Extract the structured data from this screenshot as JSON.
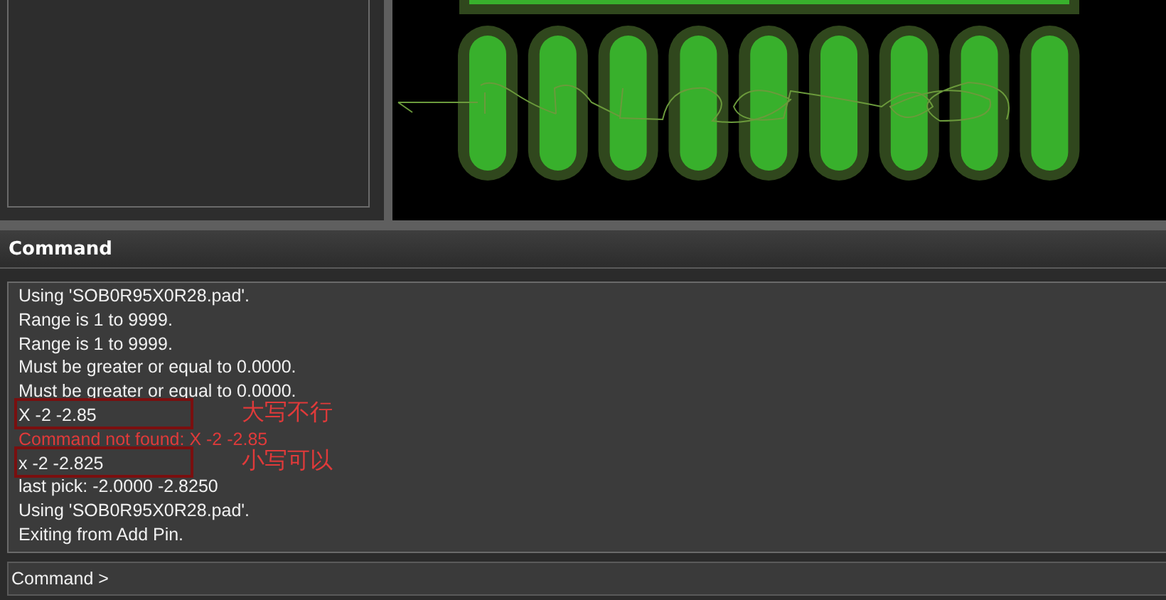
{
  "command_panel": {
    "title": "Command",
    "log": [
      {
        "text": "Using 'SOB0R95X0R28.pad'.",
        "kind": "info",
        "highlighted": false
      },
      {
        "text": "Range is 1 to 9999.",
        "kind": "info",
        "highlighted": false
      },
      {
        "text": "Range is 1 to 9999.",
        "kind": "info",
        "highlighted": false
      },
      {
        "text": "Must be greater or equal to 0.0000.",
        "kind": "info",
        "highlighted": false
      },
      {
        "text": "Must be greater or equal to 0.0000.",
        "kind": "info",
        "highlighted": false
      },
      {
        "text": "X -2 -2.85",
        "kind": "info",
        "highlighted": true,
        "note": "大写不行"
      },
      {
        "text": "Command not found: X -2 -2.85",
        "kind": "error",
        "highlighted": false
      },
      {
        "text": "x -2 -2.825",
        "kind": "info",
        "highlighted": true,
        "note": "小写可以"
      },
      {
        "text": "last pick:  -2.0000 -2.8250",
        "kind": "info",
        "highlighted": false
      },
      {
        "text": "Using 'SOB0R95X0R28.pad'.",
        "kind": "info",
        "highlighted": false
      },
      {
        "text": "Exiting from Add Pin.",
        "kind": "info",
        "highlighted": false
      }
    ],
    "prompt": "Command >"
  }
}
